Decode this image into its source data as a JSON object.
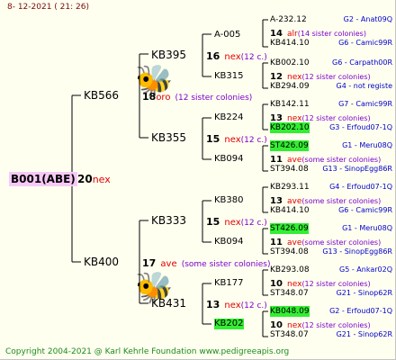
{
  "header": {
    "date": "8- 12-2021 ( 21: 26)"
  },
  "footer": {
    "copyright": "Copyright 2004-2021 @ Karl Kehrle Foundation www.pedigreeapis.org"
  },
  "root": {
    "name": "B001(ABE)",
    "gen": "20",
    "tag": "nex"
  },
  "parents": {
    "p1": {
      "name": "KB566",
      "gen": "18",
      "tag": "oro",
      "note": "(12 sister colonies)"
    },
    "p2": {
      "name": "KB400",
      "gen": "17",
      "tag": "ave",
      "note": "(some sister colonies)"
    }
  },
  "grandparents": {
    "g1": {
      "name": "KB395",
      "gen": "16",
      "tag": "nex",
      "note": "(12 c.)"
    },
    "g2": {
      "name": "KB355",
      "gen": "15",
      "tag": "nex",
      "note": "(12 c.)"
    },
    "g3": {
      "name": "KB333",
      "gen": "15",
      "tag": "nex",
      "note": "(12 c.)"
    },
    "g4": {
      "name": "KB431",
      "gen": "13",
      "tag": "nex",
      "note": "(12 c.)"
    }
  },
  "great": {
    "a": {
      "name": "A-005"
    },
    "b": {
      "name": "KB315"
    },
    "c": {
      "name": "KB224"
    },
    "d": {
      "name": "KB094"
    },
    "e": {
      "name": "KB380"
    },
    "f": {
      "name": "KB094"
    },
    "g": {
      "name": "KB177"
    },
    "h": {
      "name": "KB202"
    }
  },
  "gen4": [
    {
      "top": "A-232.12",
      "top_right": "G2 - Anat09Q",
      "mid_gen": "14",
      "mid_tag": "alr",
      "mid_note": "(14 sister colonies)",
      "bottom": "KB414.10",
      "bottom_right": "G6 - Camic99R"
    },
    {
      "top": "KB002.10",
      "top_right": "G6 - Carpath00R",
      "mid_gen": "12",
      "mid_tag": "nex",
      "mid_note": "(12 sister colonies)",
      "bottom": "KB294.09",
      "bottom_right": "G4 - not registe"
    },
    {
      "top": "KB142.11",
      "top_right": "G7 - Camic99R",
      "mid_gen": "13",
      "mid_tag": "nex",
      "mid_note": "(12 sister colonies)",
      "bottom": "KB202.10",
      "bottom_right": "G3 - Erfoud07-1Q"
    },
    {
      "top": "ST426.09",
      "top_right": "G1 - Meru08Q",
      "mid_gen": "11",
      "mid_tag": "ave",
      "mid_note": "(some sister colonies)",
      "bottom": "ST394.08",
      "bottom_right": "G13 - SinopEgg86R"
    },
    {
      "top": "KB293.11",
      "top_right": "G4 - Erfoud07-1Q",
      "mid_gen": "13",
      "mid_tag": "ave",
      "mid_note": "(some sister colonies)",
      "bottom": "KB414.10",
      "bottom_right": "G6 - Camic99R"
    },
    {
      "top": "ST426.09",
      "top_right": "G1 - Meru08Q",
      "mid_gen": "11",
      "mid_tag": "ave",
      "mid_note": "(some sister colonies)",
      "bottom": "ST394.08",
      "bottom_right": "G13 - SinopEgg86R"
    },
    {
      "top": "KB293.08",
      "top_right": "G5 - Ankar02Q",
      "mid_gen": "10",
      "mid_tag": "nex",
      "mid_note": "(12 sister colonies)",
      "bottom": "ST348.07",
      "bottom_right": "G21 - Sinop62R"
    },
    {
      "top": "KB048.09",
      "top_right": "G2 - Erfoud07-1Q",
      "mid_gen": "10",
      "mid_tag": "nex",
      "mid_note": "(12 sister colonies)",
      "bottom": "ST348.07",
      "bottom_right": "G21 - Sinop62R"
    }
  ],
  "colors": {
    "highlight": "#33ee33",
    "lines": "#000000",
    "accent": "#e00000"
  }
}
